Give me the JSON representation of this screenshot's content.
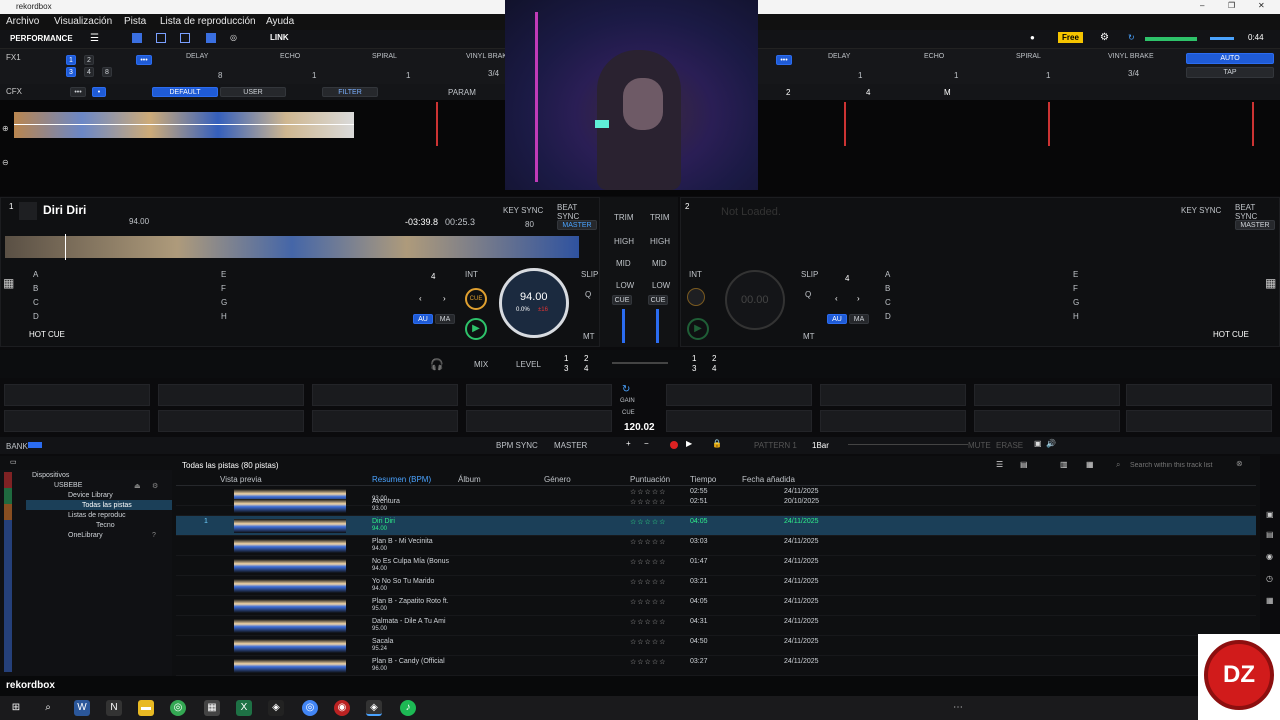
{
  "window": {
    "title": "rekordbox",
    "minimize": "–",
    "maximize": "❐",
    "close": "✕"
  },
  "menu": [
    "Archivo",
    "Visualización",
    "Pista",
    "Lista de reproducción",
    "Ayuda"
  ],
  "toolbar": {
    "mode": "PERFORMANCE",
    "link": "LINK",
    "plan": "Free",
    "time": "0:44"
  },
  "fx1": {
    "label": "FX1",
    "beats": [
      "1",
      "2",
      "3",
      "4",
      "8"
    ],
    "effects": [
      "DELAY",
      "ECHO",
      "SPIRAL",
      "VINYL BRAKE"
    ],
    "values": [
      "8",
      "1",
      "1",
      "3/4"
    ]
  },
  "fx2": {
    "effects": [
      "DELAY",
      "ECHO",
      "SPIRAL",
      "VINYL BRAKE"
    ],
    "values": [
      "1",
      "1",
      "1",
      "3/4"
    ],
    "auto": "AUTO",
    "tap": "TAP"
  },
  "cfx": {
    "label": "CFX",
    "default": "DEFAULT",
    "user": "USER",
    "filter": "FILTER",
    "param": "PARAM",
    "markers": [
      "2",
      "4",
      "M"
    ]
  },
  "deck1": {
    "number": "1",
    "title": "Diri Diri",
    "bpm_small": "94.00",
    "time_remain": "-03:39.8",
    "time_elapsed": "00:25.3",
    "key_sync": "KEY SYNC",
    "beat_sync": "BEAT SYNC",
    "master": "MASTER",
    "key_value": "80",
    "jog_bpm": "94.00",
    "pitch": "0.0%",
    "pitch_range": "±16",
    "beat_jump": "4",
    "int": "INT",
    "slip": "SLIP",
    "q": "Q",
    "mt": "MT",
    "cue": "CUE",
    "au": "AU",
    "ma": "MA",
    "hot_cue": "HOT CUE",
    "pads_left": [
      "A",
      "B",
      "C",
      "D"
    ],
    "pads_right": [
      "E",
      "F",
      "G",
      "H"
    ]
  },
  "deck2": {
    "number": "2",
    "title": "Not Loaded.",
    "key_sync": "KEY SYNC",
    "beat_sync": "BEAT SYNC",
    "master": "MASTER",
    "jog_bpm": "00.00",
    "beat_jump": "4",
    "int": "INT",
    "slip": "SLIP",
    "q": "Q",
    "mt": "MT",
    "au": "AU",
    "ma": "MA",
    "hot_cue": "HOT CUE",
    "pads_left": [
      "A",
      "B",
      "C",
      "D"
    ],
    "pads_right": [
      "E",
      "F",
      "G",
      "H"
    ]
  },
  "mixer": {
    "trim": "TRIM",
    "high": "HIGH",
    "mid": "MID",
    "low": "LOW",
    "cue": "CUE",
    "mix": "MIX",
    "level": "LEVEL",
    "gain": "GAIN",
    "master_bpm": "120.02",
    "assign_left": [
      "1",
      "2",
      "3",
      "4"
    ],
    "assign_right": [
      "1",
      "2",
      "3",
      "4"
    ]
  },
  "transport": {
    "bank": "BANK",
    "bpm_sync": "BPM SYNC",
    "master": "MASTER",
    "pattern": "PATTERN 1",
    "bar": "1Bar",
    "mute": "MUTE",
    "erase": "ERASE"
  },
  "browser": {
    "header": "Todas las pistas (80 pistas)",
    "search_placeholder": "Search within this track list",
    "columns": [
      "Vista previa",
      "Resumen (BPM)",
      "Álbum",
      "Género",
      "Puntuación",
      "Tiempo",
      "Fecha añadida"
    ],
    "tree": [
      "Dispositivos",
      "USBEBE",
      "Device Library",
      "Todas las pistas",
      "Listas de reproduc",
      "Tecno",
      "OneLibrary"
    ],
    "tracks": [
      {
        "num": "",
        "title": "",
        "bpm": "93.00",
        "rating": "☆☆☆☆☆",
        "time": "02:55",
        "date": "24/11/2025"
      },
      {
        "num": "",
        "title": "Aventura",
        "bpm": "93.00",
        "rating": "☆☆☆☆☆",
        "time": "02:51",
        "date": "20/10/2025"
      },
      {
        "num": "1",
        "title": "Diri Diri",
        "bpm": "94.00",
        "rating": "☆☆☆☆☆",
        "time": "04:05",
        "date": "24/11/2025"
      },
      {
        "num": "",
        "title": "Plan B - Mi Vecinita",
        "bpm": "94.00",
        "rating": "☆☆☆☆☆",
        "time": "03:03",
        "date": "24/11/2025"
      },
      {
        "num": "",
        "title": "No Es Culpa Mía (Bonus",
        "bpm": "94.00",
        "rating": "☆☆☆☆☆",
        "time": "01:47",
        "date": "24/11/2025"
      },
      {
        "num": "",
        "title": "Yo No So Tu Marido",
        "bpm": "94.00",
        "rating": "☆☆☆☆☆",
        "time": "03:21",
        "date": "24/11/2025"
      },
      {
        "num": "",
        "title": "Plan B - Zapatito Roto ft.",
        "bpm": "95.00",
        "rating": "☆☆☆☆☆",
        "time": "04:05",
        "date": "24/11/2025"
      },
      {
        "num": "",
        "title": "Dalmata - Dile A Tu Ami",
        "bpm": "95.00",
        "rating": "☆☆☆☆☆",
        "time": "04:31",
        "date": "24/11/2025"
      },
      {
        "num": "",
        "title": "Sacala",
        "bpm": "95.24",
        "rating": "☆☆☆☆☆",
        "time": "04:50",
        "date": "24/11/2025"
      },
      {
        "num": "",
        "title": "Plan B - Candy (Official",
        "bpm": "96.00",
        "rating": "☆☆☆☆☆",
        "time": "03:27",
        "date": "24/11/2025"
      }
    ]
  },
  "statusbar": {
    "brand": "rekordbox"
  },
  "watermark": {
    "text": "DZ"
  }
}
